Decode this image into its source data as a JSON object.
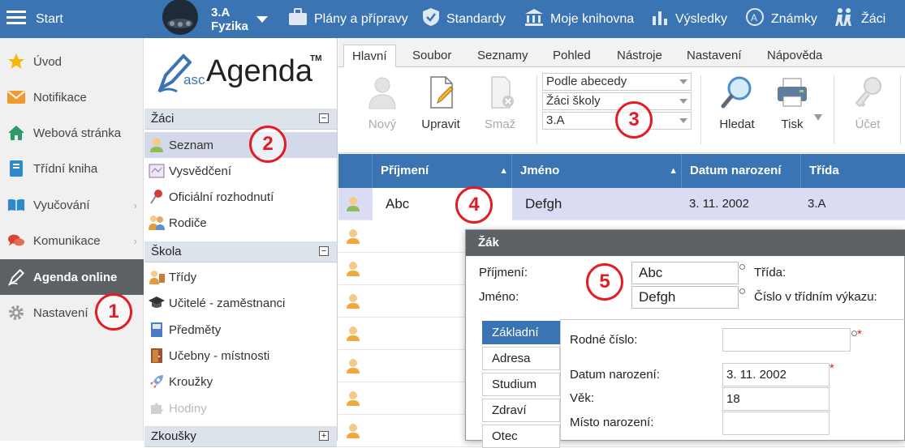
{
  "topbar": {
    "start_label": "Start",
    "class_name": "3.A",
    "subject_name": "Fyzika",
    "nav": [
      {
        "label": "Plány a přípravy",
        "icon": "briefcase-icon"
      },
      {
        "label": "Standardy",
        "icon": "shield-check-icon"
      },
      {
        "label": "Moje knihovna",
        "icon": "library-icon"
      },
      {
        "label": "Výsledky",
        "icon": "bar-chart-icon"
      },
      {
        "label": "Známky",
        "icon": "grade-icon"
      },
      {
        "label": "Žáci",
        "icon": "students-icon"
      }
    ]
  },
  "sidebar": {
    "items": [
      {
        "label": "Úvod",
        "icon": "star-icon"
      },
      {
        "label": "Notifikace",
        "icon": "envelope-icon"
      },
      {
        "label": "Webová stránka",
        "icon": "home-icon"
      },
      {
        "label": "Třídní kniha",
        "icon": "book-icon"
      },
      {
        "label": "Vyučování",
        "icon": "open-book-icon"
      },
      {
        "label": "Komunikace",
        "icon": "chat-icon"
      },
      {
        "label": "Agenda online",
        "icon": "pen-icon"
      },
      {
        "label": "Nastavení",
        "icon": "gear-icon"
      }
    ]
  },
  "logo": {
    "prefix": "asc",
    "name": "Agenda",
    "tm": "TM"
  },
  "tree": {
    "group_zaci": "Žáci",
    "zaci_items": [
      "Seznam",
      "Vysvědčení",
      "Oficiální rozhodnutí",
      "Rodiče"
    ],
    "group_skola": "Škola",
    "skola_items": [
      "Třídy",
      "Učitelé - zaměstnanci",
      "Předměty",
      "Učebny - místnosti",
      "Kroužky",
      "Hodiny"
    ],
    "group_zkousky": "Zkoušky"
  },
  "ribbon": {
    "tabs": [
      "Hlavní",
      "Soubor",
      "Seznamy",
      "Pohled",
      "Nástroje",
      "Nastavení",
      "Nápověda"
    ],
    "new_label": "Nový",
    "edit_label": "Upravit",
    "delete_label": "Smaž",
    "sort_select": "Podle abecedy",
    "scope_select": "Žáci školy",
    "class_select": "3.A",
    "search_label": "Hledat",
    "print_label": "Tisk",
    "account_label": "Účet"
  },
  "grid": {
    "columns": [
      "Příjmení",
      "Jméno",
      "Datum narození",
      "Třída"
    ],
    "rows": [
      {
        "surname": "Abc",
        "name": "Defgh",
        "birth": "3. 11. 2002",
        "class": "3.A"
      }
    ]
  },
  "dialog": {
    "title": "Žák",
    "surname_label": "Příjmení:",
    "surname_value": "Abc",
    "name_label": "Jméno:",
    "name_value": "Defgh",
    "class_label": "Třída:",
    "register_label": "Číslo v třídním výkazu:",
    "tabs": [
      "Základní",
      "Adresa",
      "Studium",
      "Zdraví",
      "Otec"
    ],
    "birth_number_label": "Rodné číslo:",
    "birth_date_label": "Datum narození:",
    "birth_date_value": "3. 11. 2002",
    "age_label": "Věk:",
    "age_value": "18",
    "birthplace_label": "Místo narození:",
    "required_mark": "*"
  },
  "callouts": [
    "1",
    "2",
    "3",
    "4",
    "5"
  ]
}
